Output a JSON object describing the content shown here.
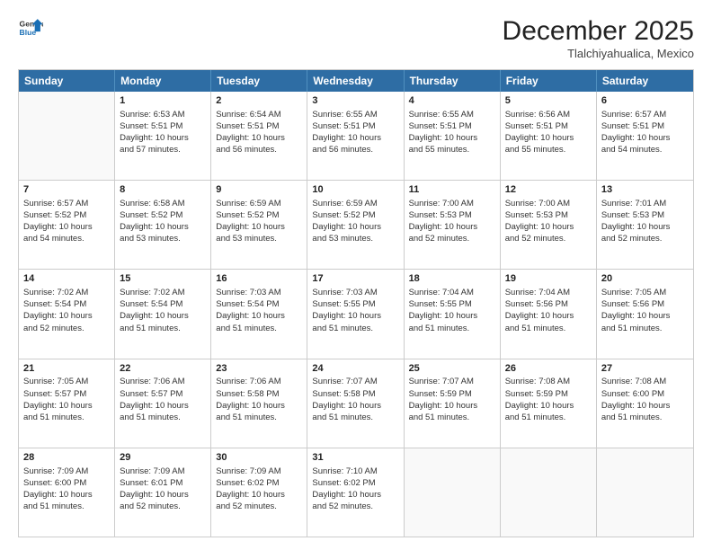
{
  "logo": {
    "general": "General",
    "blue": "Blue"
  },
  "header": {
    "month": "December 2025",
    "location": "Tlalchiyahualica, Mexico"
  },
  "days": [
    "Sunday",
    "Monday",
    "Tuesday",
    "Wednesday",
    "Thursday",
    "Friday",
    "Saturday"
  ],
  "weeks": [
    [
      {
        "day": "",
        "info": ""
      },
      {
        "day": "1",
        "info": "Sunrise: 6:53 AM\nSunset: 5:51 PM\nDaylight: 10 hours\nand 57 minutes."
      },
      {
        "day": "2",
        "info": "Sunrise: 6:54 AM\nSunset: 5:51 PM\nDaylight: 10 hours\nand 56 minutes."
      },
      {
        "day": "3",
        "info": "Sunrise: 6:55 AM\nSunset: 5:51 PM\nDaylight: 10 hours\nand 56 minutes."
      },
      {
        "day": "4",
        "info": "Sunrise: 6:55 AM\nSunset: 5:51 PM\nDaylight: 10 hours\nand 55 minutes."
      },
      {
        "day": "5",
        "info": "Sunrise: 6:56 AM\nSunset: 5:51 PM\nDaylight: 10 hours\nand 55 minutes."
      },
      {
        "day": "6",
        "info": "Sunrise: 6:57 AM\nSunset: 5:51 PM\nDaylight: 10 hours\nand 54 minutes."
      }
    ],
    [
      {
        "day": "7",
        "info": "Sunrise: 6:57 AM\nSunset: 5:52 PM\nDaylight: 10 hours\nand 54 minutes."
      },
      {
        "day": "8",
        "info": "Sunrise: 6:58 AM\nSunset: 5:52 PM\nDaylight: 10 hours\nand 53 minutes."
      },
      {
        "day": "9",
        "info": "Sunrise: 6:59 AM\nSunset: 5:52 PM\nDaylight: 10 hours\nand 53 minutes."
      },
      {
        "day": "10",
        "info": "Sunrise: 6:59 AM\nSunset: 5:52 PM\nDaylight: 10 hours\nand 53 minutes."
      },
      {
        "day": "11",
        "info": "Sunrise: 7:00 AM\nSunset: 5:53 PM\nDaylight: 10 hours\nand 52 minutes."
      },
      {
        "day": "12",
        "info": "Sunrise: 7:00 AM\nSunset: 5:53 PM\nDaylight: 10 hours\nand 52 minutes."
      },
      {
        "day": "13",
        "info": "Sunrise: 7:01 AM\nSunset: 5:53 PM\nDaylight: 10 hours\nand 52 minutes."
      }
    ],
    [
      {
        "day": "14",
        "info": "Sunrise: 7:02 AM\nSunset: 5:54 PM\nDaylight: 10 hours\nand 52 minutes."
      },
      {
        "day": "15",
        "info": "Sunrise: 7:02 AM\nSunset: 5:54 PM\nDaylight: 10 hours\nand 51 minutes."
      },
      {
        "day": "16",
        "info": "Sunrise: 7:03 AM\nSunset: 5:54 PM\nDaylight: 10 hours\nand 51 minutes."
      },
      {
        "day": "17",
        "info": "Sunrise: 7:03 AM\nSunset: 5:55 PM\nDaylight: 10 hours\nand 51 minutes."
      },
      {
        "day": "18",
        "info": "Sunrise: 7:04 AM\nSunset: 5:55 PM\nDaylight: 10 hours\nand 51 minutes."
      },
      {
        "day": "19",
        "info": "Sunrise: 7:04 AM\nSunset: 5:56 PM\nDaylight: 10 hours\nand 51 minutes."
      },
      {
        "day": "20",
        "info": "Sunrise: 7:05 AM\nSunset: 5:56 PM\nDaylight: 10 hours\nand 51 minutes."
      }
    ],
    [
      {
        "day": "21",
        "info": "Sunrise: 7:05 AM\nSunset: 5:57 PM\nDaylight: 10 hours\nand 51 minutes."
      },
      {
        "day": "22",
        "info": "Sunrise: 7:06 AM\nSunset: 5:57 PM\nDaylight: 10 hours\nand 51 minutes."
      },
      {
        "day": "23",
        "info": "Sunrise: 7:06 AM\nSunset: 5:58 PM\nDaylight: 10 hours\nand 51 minutes."
      },
      {
        "day": "24",
        "info": "Sunrise: 7:07 AM\nSunset: 5:58 PM\nDaylight: 10 hours\nand 51 minutes."
      },
      {
        "day": "25",
        "info": "Sunrise: 7:07 AM\nSunset: 5:59 PM\nDaylight: 10 hours\nand 51 minutes."
      },
      {
        "day": "26",
        "info": "Sunrise: 7:08 AM\nSunset: 5:59 PM\nDaylight: 10 hours\nand 51 minutes."
      },
      {
        "day": "27",
        "info": "Sunrise: 7:08 AM\nSunset: 6:00 PM\nDaylight: 10 hours\nand 51 minutes."
      }
    ],
    [
      {
        "day": "28",
        "info": "Sunrise: 7:09 AM\nSunset: 6:00 PM\nDaylight: 10 hours\nand 51 minutes."
      },
      {
        "day": "29",
        "info": "Sunrise: 7:09 AM\nSunset: 6:01 PM\nDaylight: 10 hours\nand 52 minutes."
      },
      {
        "day": "30",
        "info": "Sunrise: 7:09 AM\nSunset: 6:02 PM\nDaylight: 10 hours\nand 52 minutes."
      },
      {
        "day": "31",
        "info": "Sunrise: 7:10 AM\nSunset: 6:02 PM\nDaylight: 10 hours\nand 52 minutes."
      },
      {
        "day": "",
        "info": ""
      },
      {
        "day": "",
        "info": ""
      },
      {
        "day": "",
        "info": ""
      }
    ]
  ]
}
